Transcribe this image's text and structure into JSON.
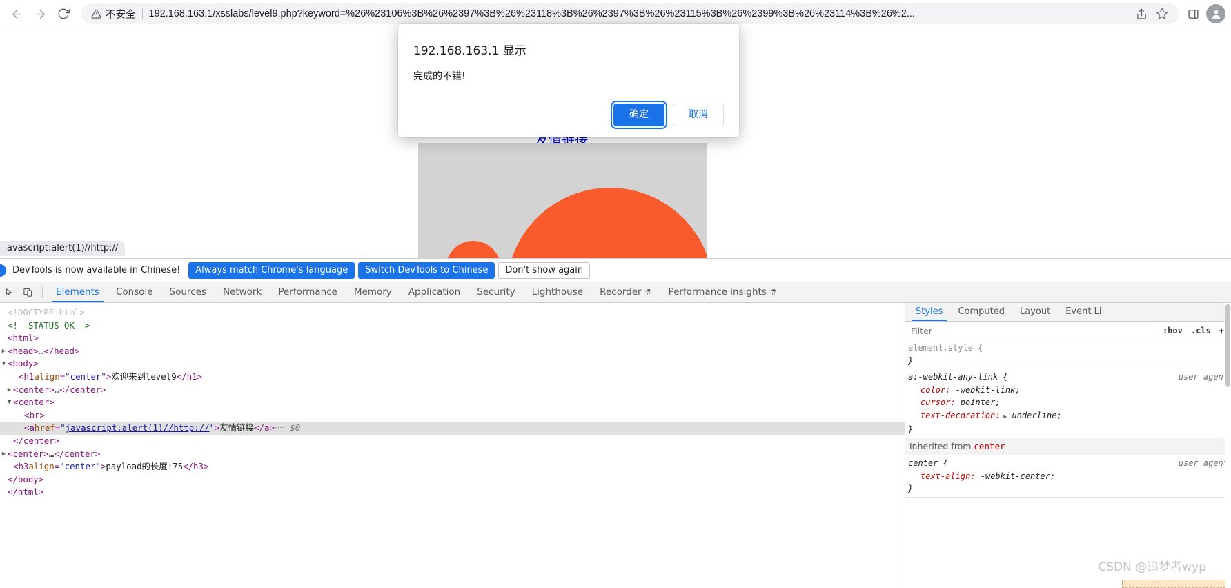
{
  "browser": {
    "back_icon": "arrow-left-icon",
    "forward_icon": "arrow-right-icon",
    "reload_icon": "reload-icon",
    "security_icon": "warning-triangle-icon",
    "security_label": "不安全",
    "url": "192.168.163.1/xsslabs/level9.php?keyword=%26%23106%3B%26%2397%3B%26%23118%3B%26%2397%3B%26%23115%3B%26%2399%3B%26%23114%3B%26%2...",
    "share_icon": "share-icon",
    "bookmark_icon": "star-icon",
    "side_panel_icon": "side-panel-icon",
    "profile_icon": "avatar-icon"
  },
  "page": {
    "link_text": "友情链接",
    "image_alt": "orange-logo-image"
  },
  "alert": {
    "title": "192.168.163.1 显示",
    "message": "完成的不错!",
    "ok_label": "确定",
    "cancel_label": "取消"
  },
  "status_bubble": {
    "text": "avascript:alert(1)//http://"
  },
  "devtools_notification": {
    "text": "DevTools is now available in Chinese!",
    "buttons": [
      {
        "label": "Always match Chrome's language",
        "style": "primary"
      },
      {
        "label": "Switch DevTools to Chinese",
        "style": "primary"
      },
      {
        "label": "Don't show again",
        "style": "plain"
      }
    ]
  },
  "devtools": {
    "inspect_icon": "inspect-cursor-icon",
    "device_icon": "device-toolbar-icon",
    "tabs": [
      {
        "label": "Elements",
        "active": true,
        "experiment": false
      },
      {
        "label": "Console",
        "active": false,
        "experiment": false
      },
      {
        "label": "Sources",
        "active": false,
        "experiment": false
      },
      {
        "label": "Network",
        "active": false,
        "experiment": false
      },
      {
        "label": "Performance",
        "active": false,
        "experiment": false
      },
      {
        "label": "Memory",
        "active": false,
        "experiment": false
      },
      {
        "label": "Application",
        "active": false,
        "experiment": false
      },
      {
        "label": "Security",
        "active": false,
        "experiment": false
      },
      {
        "label": "Lighthouse",
        "active": false,
        "experiment": false
      },
      {
        "label": "Recorder",
        "active": false,
        "experiment": true
      },
      {
        "label": "Performance insights",
        "active": false,
        "experiment": true
      }
    ]
  },
  "dom": {
    "rows": [
      {
        "indent": 0,
        "twisty": "",
        "selected": false,
        "parts": [
          {
            "cls": "c-doctype",
            "t": "<!DOCTYPE html>"
          }
        ]
      },
      {
        "indent": 0,
        "twisty": "",
        "selected": false,
        "parts": [
          {
            "cls": "c-comment",
            "t": "<!--STATUS OK-->"
          }
        ]
      },
      {
        "indent": 0,
        "twisty": "",
        "selected": false,
        "parts": [
          {
            "cls": "c-tag",
            "t": "<html>"
          }
        ]
      },
      {
        "indent": 0,
        "twisty": "▶",
        "selected": false,
        "parts": [
          {
            "cls": "c-tag",
            "t": "<head>"
          },
          {
            "cls": "c-text",
            "t": "…"
          },
          {
            "cls": "c-tag",
            "t": "</head>"
          }
        ]
      },
      {
        "indent": 0,
        "twisty": "▼",
        "selected": false,
        "parts": [
          {
            "cls": "c-tag",
            "t": "<body>"
          }
        ]
      },
      {
        "indent": 2,
        "twisty": "",
        "selected": false,
        "parts": [
          {
            "cls": "c-tag",
            "t": "<h1 "
          },
          {
            "cls": "c-attr",
            "t": "align"
          },
          {
            "cls": "c-tag",
            "t": "="
          },
          {
            "cls": "c-val",
            "t": "\"center\""
          },
          {
            "cls": "c-tag",
            "t": ">"
          },
          {
            "cls": "c-text",
            "t": "欢迎来到level9"
          },
          {
            "cls": "c-tag",
            "t": "</h1>"
          }
        ]
      },
      {
        "indent": 1,
        "twisty": "▶",
        "selected": false,
        "parts": [
          {
            "cls": "c-tag",
            "t": "<center>"
          },
          {
            "cls": "c-text",
            "t": "…"
          },
          {
            "cls": "c-tag",
            "t": "</center>"
          }
        ]
      },
      {
        "indent": 1,
        "twisty": "▼",
        "selected": false,
        "parts": [
          {
            "cls": "c-tag",
            "t": "<center>"
          }
        ]
      },
      {
        "indent": 3,
        "twisty": "",
        "selected": false,
        "parts": [
          {
            "cls": "c-tag",
            "t": "<br>"
          }
        ]
      },
      {
        "indent": 3,
        "twisty": "",
        "selected": true,
        "parts": [
          {
            "cls": "c-tag",
            "t": "<a "
          },
          {
            "cls": "c-attr",
            "t": "href"
          },
          {
            "cls": "c-tag",
            "t": "="
          },
          {
            "cls": "c-val",
            "t": "\""
          },
          {
            "cls": "c-link",
            "t": "javascript:alert(1)//http://"
          },
          {
            "cls": "c-val",
            "t": "\""
          },
          {
            "cls": "c-tag",
            "t": ">"
          },
          {
            "cls": "c-text",
            "t": "友情链接"
          },
          {
            "cls": "c-tag",
            "t": "</a>"
          },
          {
            "cls": "c-dollar",
            "t": "  == $0"
          }
        ]
      },
      {
        "indent": 1,
        "twisty": "",
        "selected": false,
        "parts": [
          {
            "cls": "c-tag",
            "t": "</center>"
          }
        ]
      },
      {
        "indent": 0,
        "twisty": "▶",
        "selected": false,
        "parts": [
          {
            "cls": "c-tag",
            "t": "<center>"
          },
          {
            "cls": "c-text",
            "t": "…"
          },
          {
            "cls": "c-tag",
            "t": "</center>"
          }
        ]
      },
      {
        "indent": 1,
        "twisty": "",
        "selected": false,
        "parts": [
          {
            "cls": "c-tag",
            "t": "<h3 "
          },
          {
            "cls": "c-attr",
            "t": "align"
          },
          {
            "cls": "c-tag",
            "t": "="
          },
          {
            "cls": "c-val",
            "t": "\"center\""
          },
          {
            "cls": "c-tag",
            "t": ">"
          },
          {
            "cls": "c-text",
            "t": "payload的长度:75"
          },
          {
            "cls": "c-tag",
            "t": "</h3>"
          }
        ]
      },
      {
        "indent": 0,
        "twisty": "",
        "selected": false,
        "parts": [
          {
            "cls": "c-tag",
            "t": "</body>"
          }
        ]
      },
      {
        "indent": 0,
        "twisty": "",
        "selected": false,
        "parts": [
          {
            "cls": "c-tag",
            "t": "</html>"
          }
        ]
      }
    ]
  },
  "styles": {
    "tabs": [
      {
        "label": "Styles",
        "active": true
      },
      {
        "label": "Computed",
        "active": false
      },
      {
        "label": "Layout",
        "active": false
      },
      {
        "label": "Event Li",
        "active": false
      }
    ],
    "filter_placeholder": "Filter",
    "hov_label": ":hov",
    "cls_label": ".cls",
    "plus_label": "+",
    "rules": [
      {
        "selector": "element.style {",
        "origin": "",
        "declarations": [],
        "close": "}"
      },
      {
        "selector": "a:-webkit-any-link {",
        "origin": "user agent",
        "declarations": [
          {
            "name": "color",
            "value": "-webkit-link;",
            "expandable": false
          },
          {
            "name": "cursor",
            "value": "pointer;",
            "expandable": false
          },
          {
            "name": "text-decoration",
            "value": "underline;",
            "expandable": true
          }
        ],
        "close": "}"
      }
    ],
    "inherited_label": "Inherited from",
    "inherited_from": "center",
    "inherited_rules": [
      {
        "selector": "center {",
        "origin": "user agent",
        "declarations": [
          {
            "name": "text-align",
            "value": "-webkit-center;",
            "expandable": false
          }
        ],
        "close": "}"
      }
    ]
  },
  "watermark": {
    "text": "CSDN @追梦者wyp"
  }
}
